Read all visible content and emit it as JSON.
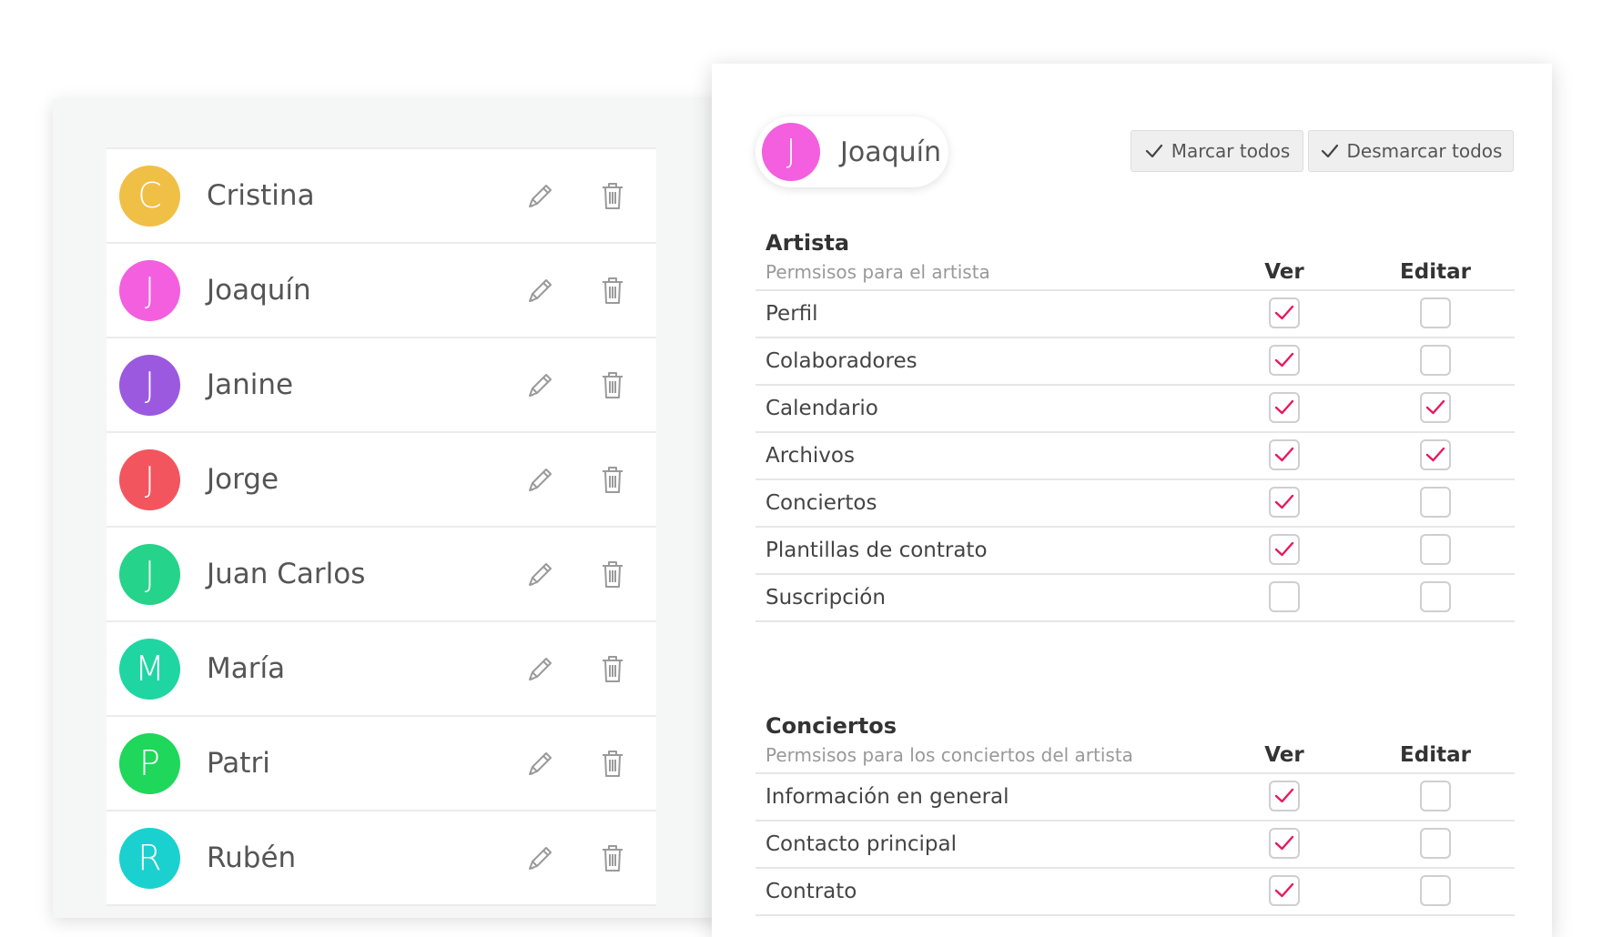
{
  "users": [
    {
      "initial": "C",
      "name": "Cristina",
      "color": "#f0bf45"
    },
    {
      "initial": "J",
      "name": "Joaquín",
      "color": "#f35fde"
    },
    {
      "initial": "J",
      "name": "Janine",
      "color": "#9b59e0"
    },
    {
      "initial": "J",
      "name": "Jorge",
      "color": "#f2555e"
    },
    {
      "initial": "J",
      "name": "Juan Carlos",
      "color": "#25d38a"
    },
    {
      "initial": "M",
      "name": "María",
      "color": "#1fd6a3"
    },
    {
      "initial": "P",
      "name": "Patri",
      "color": "#1fd75a"
    },
    {
      "initial": "R",
      "name": "Rubén",
      "color": "#1ad1cf"
    }
  ],
  "row_icons": {
    "edit": "pencil-icon",
    "delete": "trash-icon"
  },
  "selected_user": {
    "initial": "J",
    "name": "Joaquín",
    "color": "#f35fde"
  },
  "toolbar": {
    "mark_all": "Marcar todos",
    "unmark_all": "Desmarcar todos",
    "icon": "check-icon"
  },
  "accent": "#e8185f",
  "sections": [
    {
      "title": "Artista",
      "subtitle": "Permsisos para el artista",
      "col_view": "Ver",
      "col_edit": "Editar",
      "rows": [
        {
          "label": "Perfil",
          "view": true,
          "edit": false
        },
        {
          "label": "Colaboradores",
          "view": true,
          "edit": false
        },
        {
          "label": "Calendario",
          "view": true,
          "edit": true
        },
        {
          "label": "Archivos",
          "view": true,
          "edit": true
        },
        {
          "label": "Conciertos",
          "view": true,
          "edit": false
        },
        {
          "label": "Plantillas de contrato",
          "view": true,
          "edit": false
        },
        {
          "label": "Suscripción",
          "view": false,
          "edit": false
        }
      ]
    },
    {
      "title": "Conciertos",
      "subtitle": "Permsisos para los conciertos del artista",
      "col_view": "Ver",
      "col_edit": "Editar",
      "rows": [
        {
          "label": "Información en general",
          "view": true,
          "edit": false
        },
        {
          "label": "Contacto principal",
          "view": true,
          "edit": false
        },
        {
          "label": "Contrato",
          "view": true,
          "edit": false
        }
      ]
    }
  ]
}
